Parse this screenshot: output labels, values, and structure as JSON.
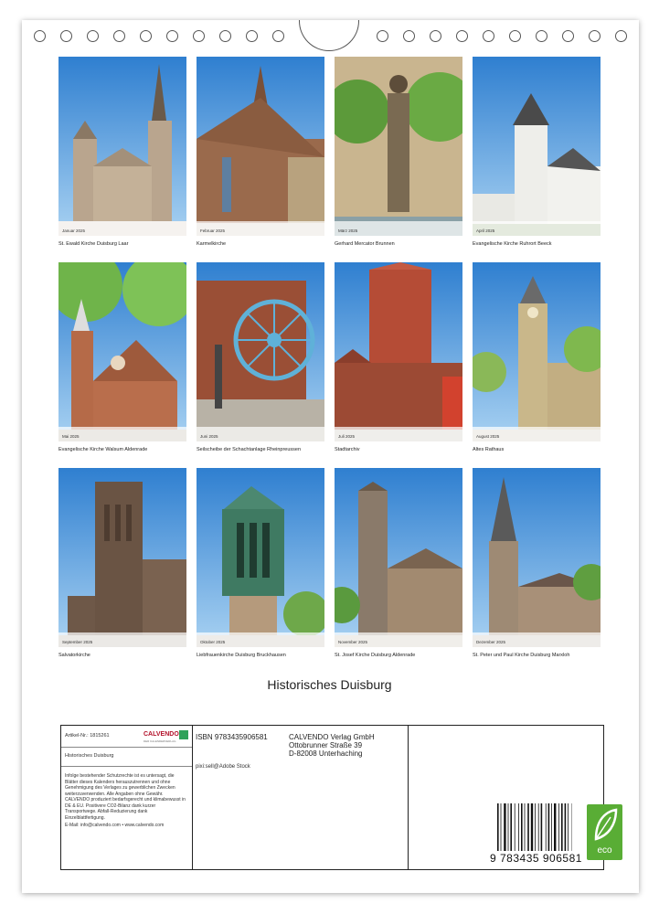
{
  "calendar_title": "Historisches Duisburg",
  "months": [
    {
      "month": "Januar 2025",
      "caption": "St. Ewald Kirche Duisburg Laar"
    },
    {
      "month": "Februar 2025",
      "caption": "Karmelkirche"
    },
    {
      "month": "März 2025",
      "caption": "Gerhard Mercator Brunnen"
    },
    {
      "month": "April 2025",
      "caption": "Evangelische Kirche Ruhrort Beeck"
    },
    {
      "month": "Mai 2025",
      "caption": "Evangelische Kirche Walsum Aldenrade"
    },
    {
      "month": "Juni 2025",
      "caption": "Seilscheibe der Schachtanlage Rheinpreussen"
    },
    {
      "month": "Juli 2025",
      "caption": "Stadtarchiv"
    },
    {
      "month": "August 2025",
      "caption": "Altes Rathaus"
    },
    {
      "month": "September 2025",
      "caption": "Salvatorkirche"
    },
    {
      "month": "Oktober 2025",
      "caption": "Liebfrauenkirche Duisburg Bruckhausen"
    },
    {
      "month": "November 2025",
      "caption": "St. Josef Kirche Duisburg Aldenrade"
    },
    {
      "month": "Dezember 2025",
      "caption": "St. Peter und Paul Kirche Duisburg Marxloh"
    }
  ],
  "info": {
    "article_no": "Artikel-Nr.: 1815261",
    "brand": "CALVENDO",
    "brand_sub": "DER KALENDERVERLAG",
    "short_title": "Historisches Duisburg",
    "legal_text": "Infolge bestehender Schutzrechte ist es untersagt, die Blätter dieses Kalenders herauszutrennen und ohne Genehmigung des Verlages zu gewerblichen Zwecken weiterzuverwenden. Alle Angaben ohne Gewähr. CALVENDO produziert bedarfsgerecht und klimabewusst in DE & EU. Positivere CO2-Bilanz dank kurzer Transportwege. Abfall-Reduzierung dank Einzelblattfertigung.",
    "email": "E-Mail: info@calvendo.com • www.calvendo.com",
    "isbn": "ISBN 9783435906581",
    "credit": "pixi:sell@Adobe Stock",
    "publisher": [
      "CALVENDO Verlag GmbH",
      "Ottobrunner Straße 39",
      "D-82008 Unterhaching"
    ],
    "barcode_number": "9 783435 906581",
    "eco_label": "eco"
  }
}
